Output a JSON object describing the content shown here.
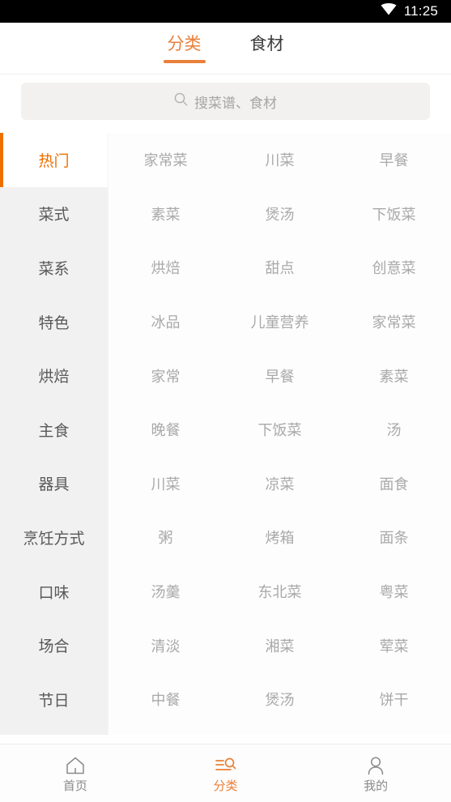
{
  "status_bar": {
    "time": "11:25",
    "wifi_icon": "wifi-icon"
  },
  "colors": {
    "accent": "#e8803a",
    "accent_bar": "#ee6f00",
    "sidebar_bg": "#f1f1f1",
    "search_bg": "#f2f1ef",
    "text_muted": "#a9a9a9"
  },
  "tabs": [
    {
      "label": "分类",
      "active": true
    },
    {
      "label": "食材",
      "active": false
    }
  ],
  "search": {
    "icon": "search-icon",
    "placeholder": "搜菜谱、食材",
    "value": ""
  },
  "sidebar": {
    "items": [
      {
        "label": "热门",
        "active": true
      },
      {
        "label": "菜式",
        "active": false
      },
      {
        "label": "菜系",
        "active": false
      },
      {
        "label": "特色",
        "active": false
      },
      {
        "label": "烘焙",
        "active": false
      },
      {
        "label": "主食",
        "active": false
      },
      {
        "label": "器具",
        "active": false
      },
      {
        "label": "烹饪方式",
        "active": false
      },
      {
        "label": "口味",
        "active": false
      },
      {
        "label": "场合",
        "active": false
      },
      {
        "label": "节日",
        "active": false
      }
    ]
  },
  "grid": {
    "items": [
      "家常菜",
      "川菜",
      "早餐",
      "素菜",
      "煲汤",
      "下饭菜",
      "烘焙",
      "甜点",
      "创意菜",
      "冰品",
      "儿童营养",
      "家常菜",
      "家常",
      "早餐",
      "素菜",
      "晚餐",
      "下饭菜",
      "汤",
      "川菜",
      "凉菜",
      "面食",
      "粥",
      "烤箱",
      "面条",
      "汤羹",
      "东北菜",
      "粤菜",
      "清淡",
      "湘菜",
      "荤菜",
      "中餐",
      "煲汤",
      "饼干"
    ]
  },
  "bottom_nav": {
    "items": [
      {
        "label": "首页",
        "icon": "home-icon",
        "active": false
      },
      {
        "label": "分类",
        "icon": "category-search-icon",
        "active": true
      },
      {
        "label": "我的",
        "icon": "person-icon",
        "active": false
      }
    ]
  }
}
